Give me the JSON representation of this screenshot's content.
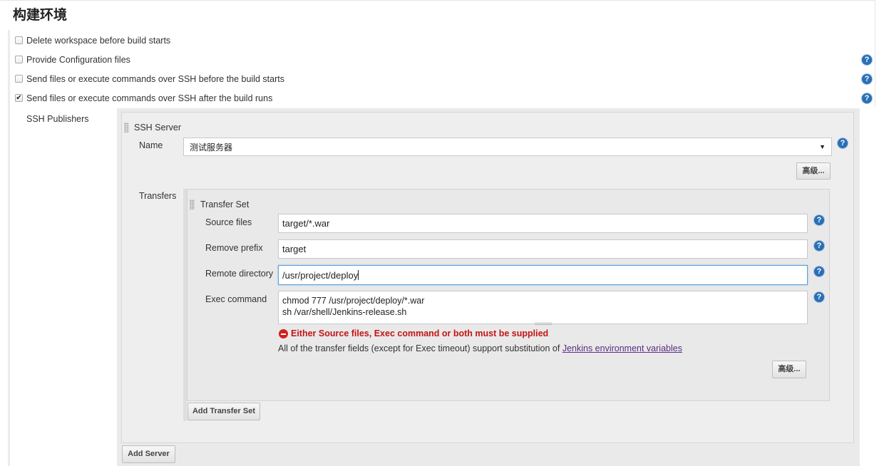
{
  "section_title": "构建环境",
  "options": [
    {
      "label": "Delete workspace before build starts",
      "checked": false,
      "help": false
    },
    {
      "label": "Provide Configuration files",
      "checked": false,
      "help": true
    },
    {
      "label": "Send files or execute commands over SSH before the build starts",
      "checked": false,
      "help": true
    },
    {
      "label": "Send files or execute commands over SSH after the build runs",
      "checked": true,
      "help": true
    }
  ],
  "ssh_publishers": {
    "label": "SSH Publishers",
    "server": {
      "header": "SSH Server",
      "name_label": "Name",
      "name_value": "测试服务器",
      "advanced_label": "高级...",
      "transfers_label": "Transfers",
      "transfer_set": {
        "header": "Transfer Set",
        "source_files_label": "Source files",
        "source_files_value": "target/*.war",
        "remove_prefix_label": "Remove prefix",
        "remove_prefix_value": "target",
        "remote_directory_label": "Remote directory",
        "remote_directory_value": "/usr/project/deploy",
        "exec_command_label": "Exec command",
        "exec_command_lines": [
          "chmod 777 /usr/project/deploy/*.war",
          "sh /var/shell/Jenkins-release.sh"
        ],
        "error_message": "Either Source files, Exec command or both must be supplied",
        "info_text": "All of the transfer fields (except for Exec timeout) support substitution of",
        "info_link": "Jenkins environment variables",
        "advanced_label": "高级..."
      },
      "add_transfer_set_label": "Add Transfer Set"
    },
    "add_server_label": "Add Server"
  },
  "colors": {
    "help_blue": "#2a6fb6",
    "error_red": "#c41414",
    "link_purple": "#5b2c83"
  }
}
